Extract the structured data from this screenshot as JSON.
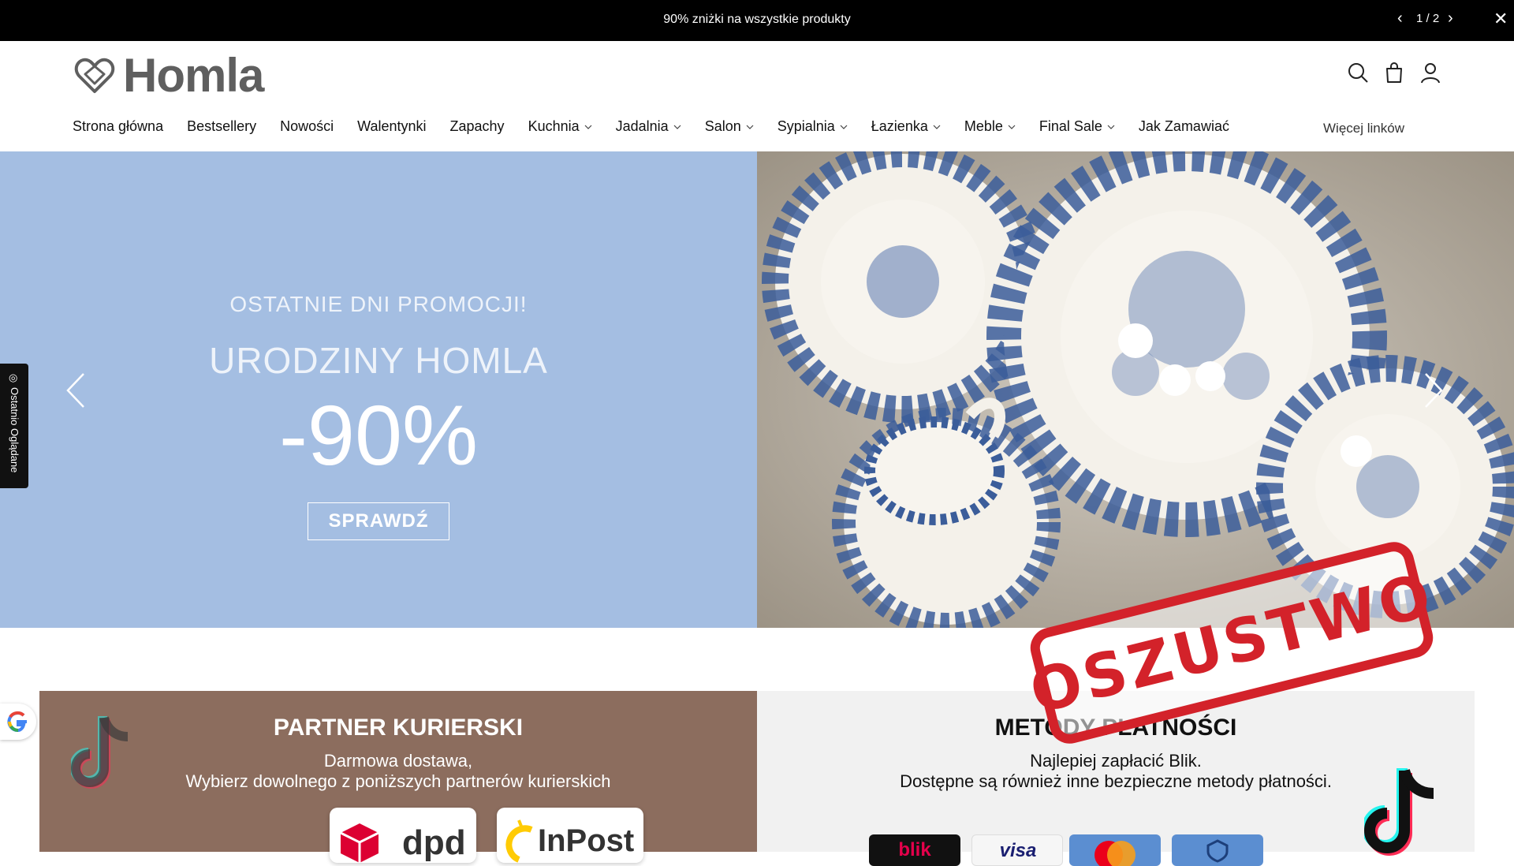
{
  "announcement": {
    "text": "90% zniżki na wszystkie produkty",
    "counter": "1 / 2",
    "prev_icon": "‹",
    "next_icon": "›",
    "close_icon": "✕"
  },
  "header": {
    "logo_text": "Homla",
    "icons": [
      "search-icon",
      "shopping-bag-icon",
      "account-icon"
    ]
  },
  "nav": {
    "items": [
      {
        "label": "Strona główna",
        "dropdown": false
      },
      {
        "label": "Bestsellery",
        "dropdown": false
      },
      {
        "label": "Nowości",
        "dropdown": false
      },
      {
        "label": "Walentynki",
        "dropdown": false
      },
      {
        "label": "Zapachy",
        "dropdown": false
      },
      {
        "label": "Kuchnia",
        "dropdown": true
      },
      {
        "label": "Jadalnia",
        "dropdown": true
      },
      {
        "label": "Salon",
        "dropdown": true
      },
      {
        "label": "Sypialnia",
        "dropdown": true
      },
      {
        "label": "Łazienka",
        "dropdown": true
      },
      {
        "label": "Meble",
        "dropdown": true
      },
      {
        "label": "Final Sale",
        "dropdown": true
      },
      {
        "label": "Jak Zamawiać",
        "dropdown": false
      }
    ],
    "more_links": "Więcej linków"
  },
  "hero": {
    "subtitle": "OSTATNIE DNI PROMOCJI!",
    "title": "URODZINY HOMLA",
    "discount": "-90%",
    "button": "SPRAWDŹ",
    "bg_color": "#a4bee2"
  },
  "recent_tab": {
    "label": "Ostatnio Oglądane"
  },
  "stamp": {
    "text": "OSZUSTWO",
    "color": "#d3222a"
  },
  "shipping_panel": {
    "title": "PARTNER KURIERSKI",
    "line1": "Darmowa dostawa,",
    "line2": "Wybierz dowolnego z poniższych partnerów kurierskich",
    "couriers": [
      "dpd",
      "InPost"
    ],
    "bg_color": "#8c6d5e"
  },
  "payment_panel": {
    "title": "METODY PŁATNOŚCI",
    "line1": "Najlepiej zapłacić Blik.",
    "line2": "Dostępne są również inne bezpieczne metody płatności.",
    "methods": [
      "blik",
      "visa",
      "mastercard",
      "secure"
    ]
  }
}
